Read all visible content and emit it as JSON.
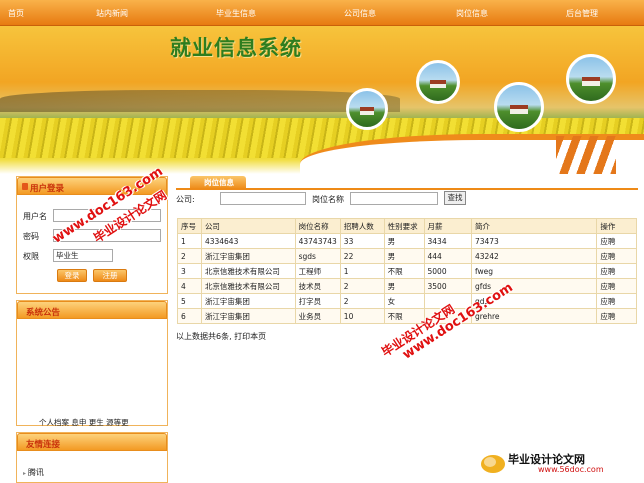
{
  "nav": {
    "items": [
      "首页",
      "站内新闻",
      "毕业生信息",
      "公司信息",
      "岗位信息",
      "后台管理"
    ]
  },
  "banner": {
    "title": "就业信息系统"
  },
  "login": {
    "title": "用户登录",
    "username_label": "用户名",
    "password_label": "密码",
    "role_label": "权限",
    "role_value": "毕业生",
    "login_button": "登录",
    "register_button": "注册"
  },
  "notice": {
    "title": "系统公告",
    "ticker": "个人档案 息申 更生 源等更"
  },
  "links": {
    "title": "友情连接",
    "items": [
      "腾讯"
    ]
  },
  "main": {
    "tab_label": "岗位信息",
    "company_label": "公司:",
    "company_value": "",
    "position_label": "岗位名称",
    "position_value": "",
    "search_button": "查找",
    "columns": [
      "序号",
      "公司",
      "岗位名称",
      "招聘人数",
      "性别要求",
      "月薪",
      "简介",
      "操作"
    ],
    "rows": [
      [
        "1",
        "4334643",
        "43743743",
        "33",
        "男",
        "3434",
        "73473",
        "应聘"
      ],
      [
        "2",
        "浙江宇宙集团",
        "sgds",
        "22",
        "男",
        "444",
        "43242",
        "应聘"
      ],
      [
        "3",
        "北京信雅技术有限公司",
        "工程师",
        "1",
        "不限",
        "5000",
        "fweg",
        "应聘"
      ],
      [
        "4",
        "北京信雅技术有限公司",
        "技术员",
        "2",
        "男",
        "3500",
        "gfds",
        "应聘"
      ],
      [
        "5",
        "浙江宇宙集团",
        "打字员",
        "2",
        "女",
        "",
        "gds",
        "应聘"
      ],
      [
        "6",
        "浙江宇宙集团",
        "业务员",
        "10",
        "不限",
        "",
        "grehre",
        "应聘"
      ]
    ],
    "summary": "以上数据共6条, 打印本页"
  },
  "watermarks": {
    "url": "www.doc163.com",
    "site": "毕业设计论文网",
    "logo_site": "毕业设计论文网",
    "logo_url": "www.56doc.com"
  },
  "colors": {
    "accent": "#ee8a17",
    "title_green": "#2e7d1f",
    "heading_red": "#c9310a",
    "watermark_red": "#e01010"
  }
}
